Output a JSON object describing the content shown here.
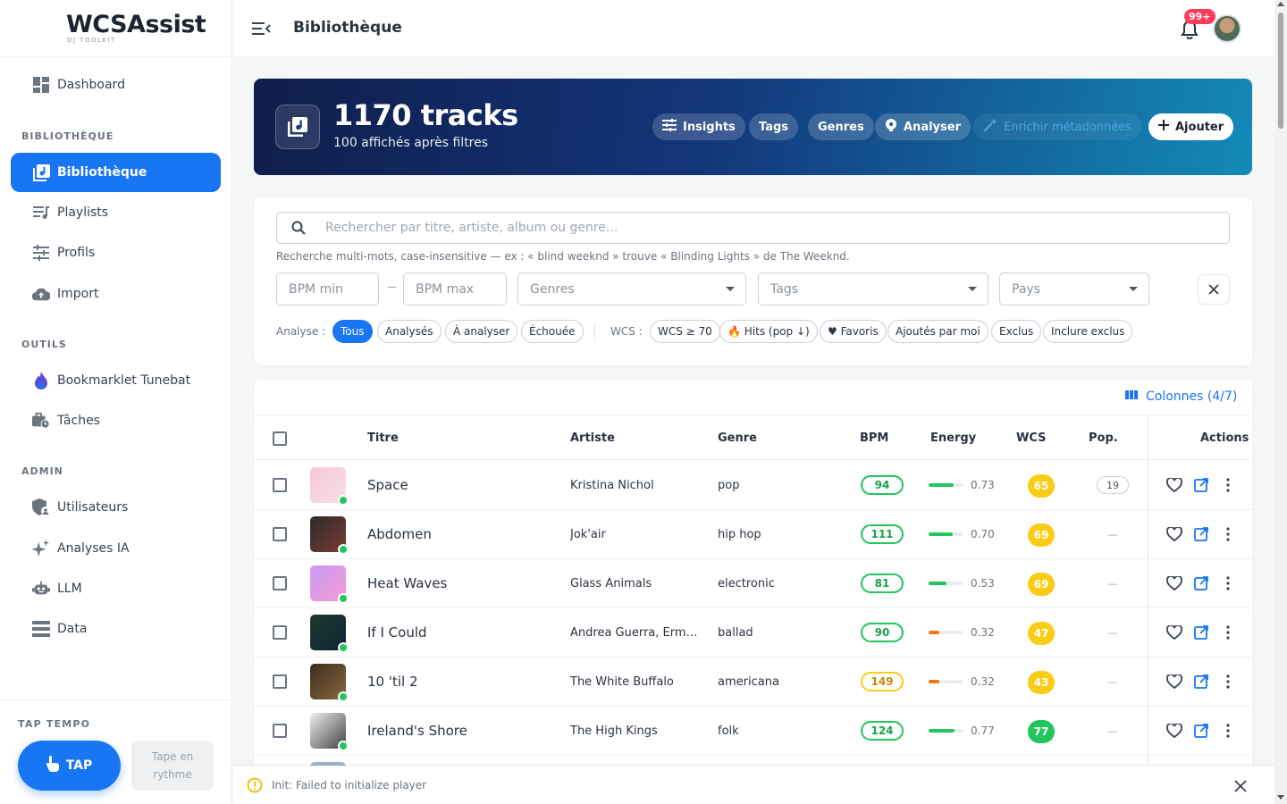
{
  "app": {
    "name": "WCSAssist",
    "subtitle": "DJ TOOLKIT"
  },
  "sidebar": {
    "top_item": {
      "label": "Dashboard",
      "icon": "dashboard-icon"
    },
    "sections": [
      {
        "title": "BIBLIOTHÈQUE"
      },
      {
        "title": "OUTILS"
      },
      {
        "title": "ADMIN"
      }
    ],
    "items": [
      {
        "label": "Bibliothèque",
        "icon": "library-music-icon",
        "active": true
      },
      {
        "label": "Playlists",
        "icon": "playlist-icon"
      },
      {
        "label": "Profils",
        "icon": "tune-sliders-icon"
      },
      {
        "label": "Import",
        "icon": "cloud-upload-icon"
      },
      {
        "label": "Bookmarklet Tunebat",
        "icon": "flame-icon"
      },
      {
        "label": "Tâches",
        "icon": "briefcase-clock-icon"
      },
      {
        "label": "Utilisateurs",
        "icon": "user-shield-icon"
      },
      {
        "label": "Analyses IA",
        "icon": "sparkle-icon"
      },
      {
        "label": "LLM",
        "icon": "robot-icon"
      },
      {
        "label": "Data",
        "icon": "database-icon"
      }
    ],
    "tap": {
      "section_title": "TAP TEMPO",
      "button_label": "TAP",
      "hint": "Tape en rythme"
    }
  },
  "topbar": {
    "title": "Bibliothèque",
    "notifications_badge": "99+"
  },
  "hero": {
    "count_label": "1170 tracks",
    "subtitle": "100 affichés après filtres",
    "buttons": {
      "insights": "Insights",
      "tags": "Tags",
      "genres": "Genres",
      "analyser": "Analyser",
      "enrichir": "Enrichir métadonnées",
      "ajouter": "Ajouter"
    }
  },
  "filters": {
    "search_placeholder": "Rechercher par titre, artiste, album ou genre...",
    "search_hint": "Recherche multi-mots, case-insensitive — ex : « blind weeknd » trouve « Blinding Lights » de The Weeknd.",
    "bpm_min_placeholder": "BPM min",
    "bpm_max_placeholder": "BPM max",
    "genres_placeholder": "Genres",
    "tags_placeholder": "Tags",
    "pays_placeholder": "Pays",
    "analyse_label": "Analyse :",
    "analyse_chips": [
      "Tous",
      "Analysés",
      "À analyser",
      "Échouée"
    ],
    "wcs_label": "WCS :",
    "wcs_chips": [
      "WCS ≥ 70",
      "🔥 Hits (pop ↓)",
      "♥ Favoris",
      "Ajoutés par moi",
      "Exclus",
      "Inclure exclus"
    ]
  },
  "table": {
    "columns_button": "Colonnes (4/7)",
    "headers": {
      "title": "Titre",
      "artist": "Artiste",
      "genre": "Genre",
      "bpm": "BPM",
      "energy": "Energy",
      "wcs": "WCS",
      "pop": "Pop.",
      "actions": "Actions"
    },
    "rows": [
      {
        "title": "Space",
        "artist": "Kristina Nichol",
        "genre": "pop",
        "bpm": "94",
        "bpm_status": "ok",
        "energy": "0.73",
        "energy_value": 0.73,
        "energy_color": "#22c55e",
        "wcs": "65",
        "wcs_color": "#facc15",
        "pop": "19",
        "thumb_colors": [
          "#f9c6d9",
          "#f5e0e6"
        ]
      },
      {
        "title": "Abdomen",
        "artist": "Jok'air",
        "genre": "hip hop",
        "bpm": "111",
        "bpm_status": "ok",
        "energy": "0.70",
        "energy_value": 0.7,
        "energy_color": "#22c55e",
        "wcs": "69",
        "wcs_color": "#facc15",
        "pop": "—",
        "thumb_colors": [
          "#2b2b2b",
          "#7a3d33"
        ]
      },
      {
        "title": "Heat Waves",
        "artist": "Glass Animals",
        "genre": "electronic",
        "bpm": "81",
        "bpm_status": "ok",
        "energy": "0.53",
        "energy_value": 0.53,
        "energy_color": "#22c55e",
        "wcs": "69",
        "wcs_color": "#facc15",
        "pop": "—",
        "thumb_colors": [
          "#c99af0",
          "#f29ad8"
        ]
      },
      {
        "title": "If I Could",
        "artist": "Andrea Guerra, Erman...",
        "genre": "ballad",
        "bpm": "90",
        "bpm_status": "ok",
        "energy": "0.32",
        "energy_value": 0.32,
        "energy_color": "#f97316",
        "wcs": "47",
        "wcs_color": "#facc15",
        "pop": "—",
        "thumb_colors": [
          "#1f3a2c",
          "#0e2236"
        ]
      },
      {
        "title": "10 'til 2",
        "artist": "The White Buffalo",
        "genre": "americana",
        "bpm": "149",
        "bpm_status": "warn",
        "energy": "0.32",
        "energy_value": 0.32,
        "energy_color": "#f97316",
        "wcs": "43",
        "wcs_color": "#facc15",
        "pop": "—",
        "thumb_colors": [
          "#3b2a1c",
          "#8a6a40"
        ]
      },
      {
        "title": "Ireland's Shore",
        "artist": "The High Kings",
        "genre": "folk",
        "bpm": "124",
        "bpm_status": "ok",
        "energy": "0.77",
        "energy_value": 0.77,
        "energy_color": "#22c55e",
        "wcs": "77",
        "wcs_color": "#22c55e",
        "pop": "—",
        "thumb_colors": [
          "#eeeeee",
          "#444444"
        ]
      }
    ]
  },
  "snackbar": {
    "message": "Init: Failed to initialize player"
  },
  "colors": {
    "primary": "#1976f2",
    "success": "#22c55e",
    "warning": "#facc15",
    "danger": "#ff3b5b"
  }
}
